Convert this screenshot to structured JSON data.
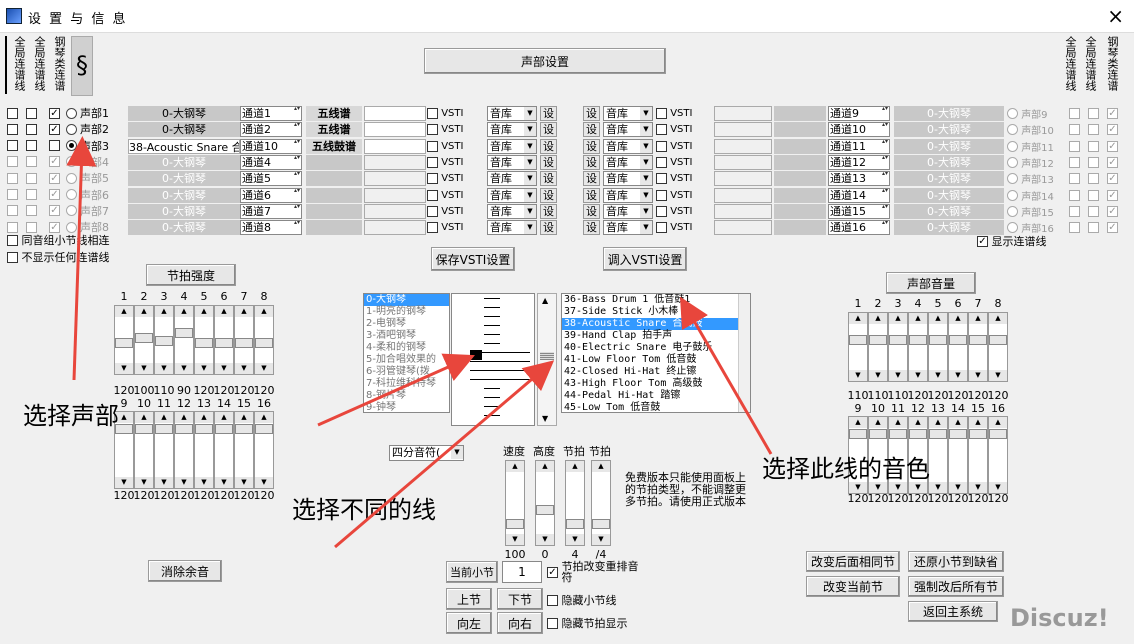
{
  "window": {
    "title": "设 置 与 信 息",
    "close": "×"
  },
  "top": {
    "voice_settings": "声部设置",
    "left_v1": "全局连谱线",
    "left_v2": "全局连谱线",
    "left_v3": "钢琴类连谱",
    "right_v1": "全局连谱线",
    "right_v2": "全局连谱线",
    "right_v3": "钢琴类连谱"
  },
  "left_rows": [
    {
      "voice": "声部1",
      "inst": "0-大钢琴",
      "chan": "通道1",
      "staff": "五线谱",
      "vsti": "VSTI",
      "lib": "音库",
      "set": "设",
      "c1": "",
      "c2": "",
      "c3": "✓",
      "active": true
    },
    {
      "voice": "声部2",
      "inst": "0-大钢琴",
      "chan": "通道2",
      "staff": "五线谱",
      "vsti": "VSTI",
      "lib": "音库",
      "set": "设",
      "c1": "",
      "c2": "",
      "c3": "✓",
      "active": true
    },
    {
      "voice": "声部3",
      "inst": "38-Acoustic Snare 合",
      "chan": "通道10",
      "staff": "五线鼓谱",
      "vsti": "VSTI",
      "lib": "音库",
      "set": "设",
      "c1": "",
      "c2": "",
      "c3": "",
      "active": true
    },
    {
      "voice": "声部4",
      "inst": "0-大钢琴",
      "chan": "通道4",
      "staff": "",
      "vsti": "VSTI",
      "lib": "音库",
      "set": "设",
      "c1": "",
      "c2": "",
      "c3": "✓",
      "active": false
    },
    {
      "voice": "声部5",
      "inst": "0-大钢琴",
      "chan": "通道5",
      "staff": "",
      "vsti": "VSTI",
      "lib": "音库",
      "set": "设",
      "c1": "",
      "c2": "",
      "c3": "✓",
      "active": false
    },
    {
      "voice": "声部6",
      "inst": "0-大钢琴",
      "chan": "通道6",
      "staff": "",
      "vsti": "VSTI",
      "lib": "音库",
      "set": "设",
      "c1": "",
      "c2": "",
      "c3": "✓",
      "active": false
    },
    {
      "voice": "声部7",
      "inst": "0-大钢琴",
      "chan": "通道7",
      "staff": "",
      "vsti": "VSTI",
      "lib": "音库",
      "set": "设",
      "c1": "",
      "c2": "",
      "c3": "✓",
      "active": false
    },
    {
      "voice": "声部8",
      "inst": "0-大钢琴",
      "chan": "通道8",
      "staff": "",
      "vsti": "VSTI",
      "lib": "音库",
      "set": "设",
      "c1": "",
      "c2": "",
      "c3": "✓",
      "active": false
    }
  ],
  "right_rows": [
    {
      "voice": "声部9",
      "inst": "0-大钢琴",
      "chan": "通道9",
      "set": "设",
      "lib": "音库",
      "vsti": "VSTI"
    },
    {
      "voice": "声部10",
      "inst": "0-大钢琴",
      "chan": "通道10",
      "set": "设",
      "lib": "音库",
      "vsti": "VSTI"
    },
    {
      "voice": "声部11",
      "inst": "0-大钢琴",
      "chan": "通道11",
      "set": "设",
      "lib": "音库",
      "vsti": "VSTI"
    },
    {
      "voice": "声部12",
      "inst": "0-大钢琴",
      "chan": "通道12",
      "set": "设",
      "lib": "音库",
      "vsti": "VSTI"
    },
    {
      "voice": "声部13",
      "inst": "0-大钢琴",
      "chan": "通道13",
      "set": "设",
      "lib": "音库",
      "vsti": "VSTI"
    },
    {
      "voice": "声部14",
      "inst": "0-大钢琴",
      "chan": "通道14",
      "set": "设",
      "lib": "音库",
      "vsti": "VSTI"
    },
    {
      "voice": "声部15",
      "inst": "0-大钢琴",
      "chan": "通道15",
      "set": "设",
      "lib": "音库",
      "vsti": "VSTI"
    },
    {
      "voice": "声部16",
      "inst": "0-大钢琴",
      "chan": "通道16",
      "set": "设",
      "lib": "音库",
      "vsti": "VSTI"
    }
  ],
  "options": {
    "same_group": "同音组小节线相连",
    "hide_ties": "不显示任何连谱线",
    "show_ties": "显示连谱线"
  },
  "buttons": {
    "save_vsti": "保存VSTI设置",
    "load_vsti": "调入VSTI设置",
    "beat_strength": "节拍强度",
    "voice_volume": "声部音量",
    "clear_sound": "消除余音",
    "current_bar": "当前小节",
    "bar_value": "1",
    "prev": "上节",
    "next": "下节",
    "left": "向左",
    "right": "向右",
    "change_same": "改变后面相同节",
    "restore": "还原小节到缺省",
    "change_current": "改变当前节",
    "force_all": "强制改后所有节",
    "back_main": "返回主系统"
  },
  "checks": {
    "beat_rearrange": "节拍改变重排音符",
    "hide_bar": "隐藏小节线",
    "hide_beat": "隐藏节拍显示"
  },
  "beat": {
    "cols_top": [
      "1",
      "2",
      "3",
      "4",
      "5",
      "6",
      "7",
      "8"
    ],
    "vals_top": [
      "120",
      "100",
      "110",
      "90",
      "120",
      "120",
      "120",
      "120"
    ],
    "cols_bot": [
      "9",
      "10",
      "11",
      "12",
      "13",
      "14",
      "15",
      "16"
    ],
    "vals_bot": [
      "120",
      "120",
      "120",
      "120",
      "120",
      "120",
      "120",
      "120"
    ],
    "levels_top": [
      0.5,
      0.62,
      0.55,
      0.75,
      0.5,
      0.5,
      0.5,
      0.5
    ]
  },
  "volume": {
    "cols_top": [
      "1",
      "2",
      "3",
      "4",
      "5",
      "6",
      "7",
      "8"
    ],
    "vals_top": [
      "110",
      "110",
      "110",
      "120",
      "120",
      "120",
      "120",
      "120"
    ],
    "cols_bot": [
      "9",
      "10",
      "11",
      "12",
      "13",
      "14",
      "15",
      "16"
    ],
    "vals_bot": [
      "120",
      "120",
      "120",
      "120",
      "120",
      "120",
      "120",
      "120"
    ]
  },
  "inst_list": [
    "0-大钢琴",
    "1-明亮的钢琴",
    "2-电钢琴",
    "3-酒吧钢琴",
    "4-柔和的钢琴",
    "5-加合唱效果的",
    "6-羽管键琴(拨",
    "7-科拉维科特琴",
    "8-钢片琴",
    "9-钟琴"
  ],
  "note_list": [
    "36-Bass Drum 1 低音鼓1",
    "37-Side Stick 小木棒",
    "38-Acoustic Snare 合成鼓",
    "39-Hand Clap 拍手声",
    "40-Electric Snare 电子鼓乐",
    "41-Low Floor Tom 低音鼓",
    "42-Closed Hi-Hat 终止镲",
    "43-High Floor Tom 高级鼓",
    "44-Pedal Hi-Hat 踏镲",
    "45-Low Tom 低音鼓"
  ],
  "beat_type": "四分音符(",
  "tempo": {
    "labels": [
      "速度",
      "高度",
      "节拍",
      "节拍"
    ],
    "vals": [
      "100",
      "0",
      "4",
      "/4"
    ]
  },
  "notice": "免费版本只能使用面板上的节拍类型，不能调整更多节拍。请使用正式版本",
  "annotations": {
    "a1": "选择声部",
    "a2": "选择不同的线",
    "a3": "选择此线的音色"
  },
  "watermark": "Discuz!"
}
